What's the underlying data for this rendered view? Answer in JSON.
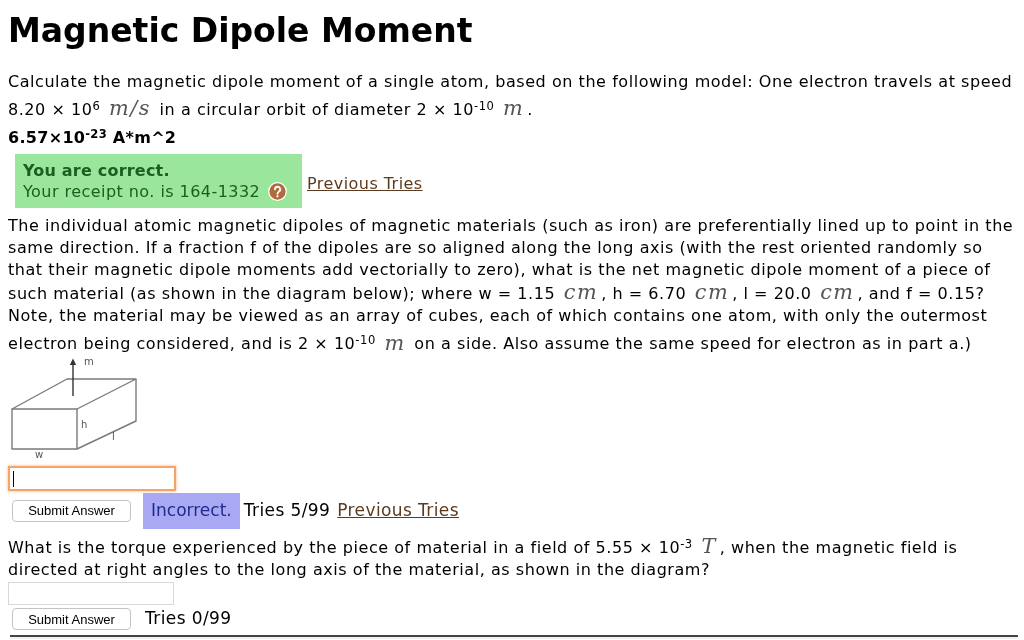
{
  "title": "Magnetic Dipole Moment",
  "parts": [
    {
      "question": "Calculate the magnetic dipole moment of a single atom, based on the following model: One electron travels at speed 8.20 × 10$^{6}$ *m/s* in a circular orbit of diameter 2 × 10$^{-10}$ *m*.",
      "answer": "6.57×10$^{-23}$ A*m^2",
      "feedback": {
        "kind": "correct",
        "heading": "You are correct.",
        "receipt": "Your receipt no. is 164-1332"
      },
      "previous_tries_link": "Previous Tries"
    },
    {
      "question": "The individual atomic magnetic dipoles of magnetic materials (such as iron) are preferentially lined up to point in the same direction. If a fraction f of the dipoles are so aligned along the long axis (with the rest oriented randomly so that their magnetic dipole moments add vectorially to zero), what is the net magnetic dipole moment of a piece of such material (as shown in the diagram below); where w = 1.15 *cm*, h = 6.70 *cm*, l = 20.0 *cm*, and f = 0.15? Note, the material may be viewed as an array of cubes, each of which contains one atom, with only the outermost electron being considered, and is 2 × 10$^{-10}$ *m* on a side. Also assume the same speed for electron as in part a.)",
      "diagram": {
        "moment_label": "m",
        "height_label": "h",
        "length_label": "l",
        "width_label": "w"
      },
      "input": {
        "focused": true
      },
      "submit_button": "Submit Answer",
      "feedback": {
        "kind": "incorrect",
        "text": "Incorrect."
      },
      "tries": "Tries 5/99",
      "previous_tries_link": "Previous Tries"
    },
    {
      "question": "What is the torque experienced by the piece of material in a field of 5.55 × 10$^{-3}$ *T*, when the magnetic field is directed at right angles to the long axis of the material, as shown in the diagram?",
      "input": {
        "focused": false
      },
      "submit_button": "Submit Answer",
      "tries": "Tries 0/99"
    }
  ]
}
